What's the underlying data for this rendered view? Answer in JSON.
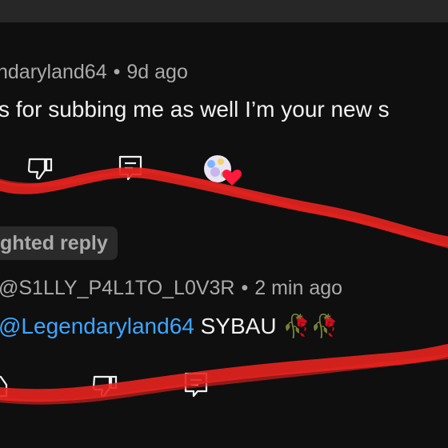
{
  "comment": {
    "author": "ndaryland64",
    "time": "9d ago",
    "text": "s for subbing me as well I’m your new s"
  },
  "highlighted_badge": "ghted reply",
  "reply": {
    "author": "@S1LLY_P4L1TO_L0V3R",
    "time": "2 min ago",
    "mention": "@Legendaryland64",
    "text": "SYBAU",
    "emoji": "🥀🥀"
  },
  "separator": "•",
  "colors": {
    "background": "#0f0f0f",
    "mention": "#3ea6ff",
    "scribble": "#e8231f",
    "heart": "#ff1a3c"
  },
  "icons": {
    "dislike": "thumbs-down-icon",
    "reply": "reply-comment-icon",
    "like": "thumbs-up-icon",
    "heart_badge": "creator-heart-icon"
  }
}
